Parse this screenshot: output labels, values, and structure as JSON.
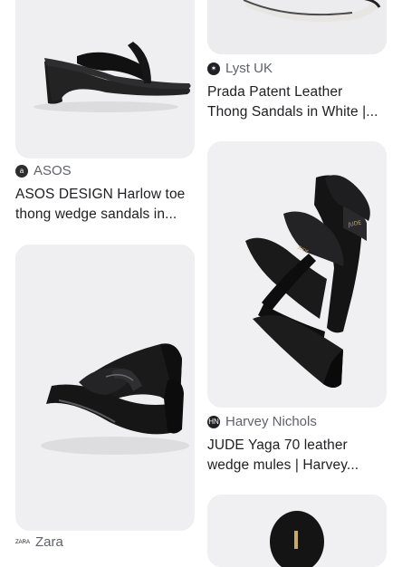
{
  "results": [
    {
      "source": "ASOS",
      "source_icon": "asos-logo-icon",
      "title_lines": [
        "ASOS DESIGN Harlow toe",
        "thong wedge sandals in..."
      ]
    },
    {
      "source": "Zara",
      "source_icon": "zara-logo-icon",
      "title_lines": []
    },
    {
      "source": "Lyst UK",
      "source_icon": "lyst-logo-icon",
      "title_lines": [
        "Prada Patent Leather",
        "Thong Sandals in White |..."
      ]
    },
    {
      "source": "Harvey Nichols",
      "source_icon": "harvey-nichols-logo-icon",
      "title_lines": [
        "JUDE Yaga 70 leather",
        "wedge mules | Harvey..."
      ]
    }
  ]
}
